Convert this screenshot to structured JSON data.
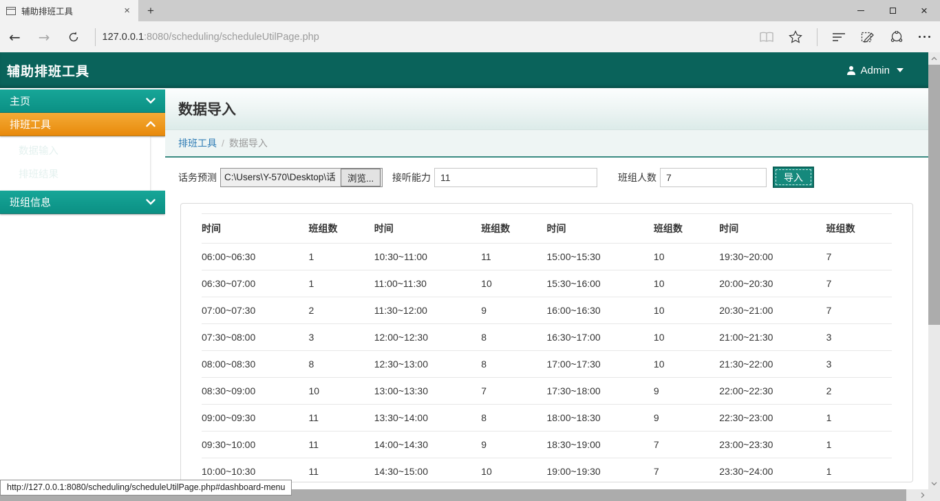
{
  "browser": {
    "tab_title": "辅助排班工具",
    "new_tab_label": "+",
    "url_host": "127.0.0.1",
    "url_rest": ":8080/scheduling/scheduleUtilPage.php",
    "status_url": "http://127.0.0.1:8080/scheduling/scheduleUtilPage.php#dashboard-menu"
  },
  "app_header": {
    "title": "辅助排班工具",
    "user_label": "Admin"
  },
  "sidebar": {
    "items": [
      {
        "label": "主页",
        "state": "collapsed"
      },
      {
        "label": "排班工具",
        "state": "expanded"
      },
      {
        "label": "班组信息",
        "state": "collapsed"
      }
    ],
    "submenu": [
      {
        "label": "数据输入"
      },
      {
        "label": "排班结果"
      }
    ]
  },
  "page": {
    "title": "数据导入",
    "breadcrumb_parent": "排班工具",
    "breadcrumb_sep": "/",
    "breadcrumb_current": "数据导入"
  },
  "form": {
    "file_label": "话务预测",
    "file_value": "C:\\Users\\Y-570\\Desktop\\话",
    "browse_label": "浏览...",
    "capacity_label": "接听能力",
    "capacity_value": "11",
    "team_label": "班组人数",
    "team_value": "7",
    "import_label": "导入"
  },
  "schedule_table": {
    "headers": [
      "时间",
      "班组数",
      "时间",
      "班组数",
      "时间",
      "班组数",
      "时间",
      "班组数"
    ],
    "rows": [
      [
        "06:00~06:30",
        "1",
        "10:30~11:00",
        "11",
        "15:00~15:30",
        "10",
        "19:30~20:00",
        "7"
      ],
      [
        "06:30~07:00",
        "1",
        "11:00~11:30",
        "10",
        "15:30~16:00",
        "10",
        "20:00~20:30",
        "7"
      ],
      [
        "07:00~07:30",
        "2",
        "11:30~12:00",
        "9",
        "16:00~16:30",
        "10",
        "20:30~21:00",
        "7"
      ],
      [
        "07:30~08:00",
        "3",
        "12:00~12:30",
        "8",
        "16:30~17:00",
        "10",
        "21:00~21:30",
        "3"
      ],
      [
        "08:00~08:30",
        "8",
        "12:30~13:00",
        "8",
        "17:00~17:30",
        "10",
        "21:30~22:00",
        "3"
      ],
      [
        "08:30~09:00",
        "10",
        "13:00~13:30",
        "7",
        "17:30~18:00",
        "9",
        "22:00~22:30",
        "2"
      ],
      [
        "09:00~09:30",
        "11",
        "13:30~14:00",
        "8",
        "18:00~18:30",
        "9",
        "22:30~23:00",
        "1"
      ],
      [
        "09:30~10:00",
        "11",
        "14:00~14:30",
        "9",
        "18:30~19:00",
        "7",
        "23:00~23:30",
        "1"
      ],
      [
        "10:00~10:30",
        "11",
        "14:30~15:00",
        "10",
        "19:00~19:30",
        "7",
        "23:30~24:00",
        "1"
      ]
    ]
  },
  "colors": {
    "header_teal": "#0a635b",
    "menu_teal": "#0f9c8f",
    "active_orange": "#ee9a1f",
    "link_blue": "#2e7cb5",
    "import_button_teal": "#15897c"
  }
}
